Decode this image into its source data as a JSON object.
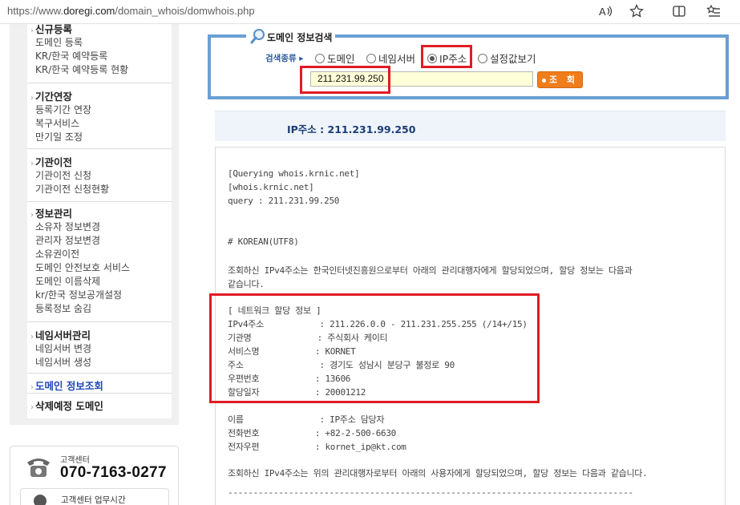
{
  "browser": {
    "url_prefix": "https://www.",
    "url_domain": "doregi.com",
    "url_path": "/domain_whois/domwhois.php",
    "icons": [
      "read-aloud-icon",
      "favorite-star-icon",
      "split-screen-icon",
      "favorites-list-icon"
    ]
  },
  "sidebar": {
    "groups": [
      {
        "head": "신규등록",
        "items": [
          "도메인 등록",
          "KR/한국 예약등록",
          "KR/한국 예약등록 현황"
        ]
      },
      {
        "head": "기간연장",
        "items": [
          "등록기간 연장",
          "복구서비스",
          "만기일 조정"
        ]
      },
      {
        "head": "기관이전",
        "items": [
          "기관이전 신청",
          "기관이전 신청현황"
        ]
      },
      {
        "head": "정보관리",
        "items": [
          "소유자 정보변경",
          "관리자 정보변경",
          "소유권이전",
          "도메인 안전보호 서비스",
          "도메인 이름삭제",
          "kr/한국 정보공개설정",
          "등록정보 숨김"
        ]
      },
      {
        "head": "네임서버관리",
        "items": [
          "네임서버 변경",
          "네임서버 생성"
        ]
      },
      {
        "head": "도메인 정보조회",
        "items": []
      },
      {
        "head": "삭제예정 도메인",
        "items": []
      }
    ],
    "customer_center": {
      "label": "고객센터",
      "phone": "070-7163-0277",
      "hours_label": "고객센터 업무시간"
    }
  },
  "search": {
    "title": "도메인 정보검색",
    "type_label": "검색종류",
    "options": [
      "도메인",
      "네임서버",
      "IP주소",
      "설정값보기"
    ],
    "selected": "IP주소",
    "input_value": "211.231.99.250",
    "button_label": "조 회"
  },
  "result": {
    "header": "IP주소 : 211.231.99.250",
    "lines": {
      "q1": "[Querying whois.krnic.net]",
      "q2": "[whois.krnic.net]",
      "q3": "query : 211.231.99.250",
      "enc": "# KOREAN(UTF8)",
      "intro1": "조회하신 IPv4주소는 한국인터넷진흥원으로부터 아래의 관리대행자에게 할당되었으며, 할당 정보는 다음과",
      "intro2": "같습니다.",
      "net_title": "[ 네트워크 할당 정보 ]",
      "ipv4": "IPv4주소           : 211.226.0.0 - 211.231.255.255 (/14+/15)",
      "org": "기관명             : 주식회사 케이티",
      "svc": "서비스명           : KORNET",
      "addr": "주소               : 경기도 성남시 분당구 불정로 90",
      "zip": "우편번호           : 13606",
      "date": "할당일자           : 20001212",
      "name": "이름               : IP주소 담당자",
      "tel": "전화번호           : +82-2-500-6630",
      "email": "전자우편           : kornet_ip@kt.com",
      "outro": "조회하신 IPv4주소는 위의 관리대행자로부터 아래의 사용자에게 할당되었으며, 할당 정보는 다음과 같습니다.",
      "dashes": "--------------------------------------------------------------------------------"
    }
  },
  "colors": {
    "highlight": "#e01b24",
    "panel_border": "#6a9fd4",
    "button": "#ef7d1c",
    "link_selected": "#2147b5"
  }
}
